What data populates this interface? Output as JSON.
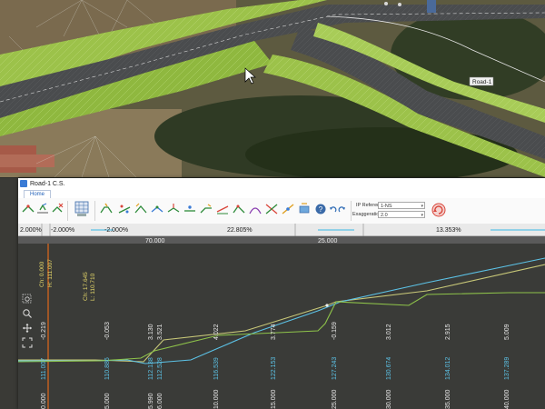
{
  "window": {
    "title": "Road-1 C.S.",
    "tabs": [
      {
        "label": "Home",
        "active": true
      }
    ]
  },
  "ribbon": {
    "ip_reference": {
      "label": "IP Reference:",
      "value": "1-NS"
    },
    "exaggeration": {
      "label": "Exaggeration:",
      "value": "2.0"
    }
  },
  "scene": {
    "road_label": "Road-1"
  },
  "profile": {
    "grade_labels": [
      {
        "text": "2.000%"
      },
      {
        "text": "-2.000%"
      },
      {
        "text": "-2.000%"
      },
      {
        "text": "22.805%"
      },
      {
        "text": "13.353%"
      }
    ],
    "width_labels": [
      {
        "text": "70.000"
      },
      {
        "text": "25.000"
      }
    ],
    "centerline_label_1": "Ch: 0.000",
    "centerline_label_2": "H: 111.007",
    "ch_label_1": "Ch: 17.645",
    "ch_label_2": "L: 110.710",
    "offset_labels": [
      "-0.219",
      "-0.053",
      "3.130",
      "3.521",
      "4.022",
      "3.774",
      "-0.159",
      "3.012",
      "2.915",
      "5.009"
    ],
    "elevation_labels": [
      "111.007",
      "110.886",
      "112.138",
      "112.528",
      "116.539",
      "122.153",
      "127.243",
      "130.674",
      "134.012",
      "137.289"
    ],
    "chainage_labels": [
      "0.000",
      "5.000",
      "5.990",
      "6.000",
      "10.000",
      "15.000",
      "25.000",
      "30.000",
      "35.000",
      "40.000"
    ]
  },
  "colors": {
    "accent": "#1f5fb8",
    "viewer_bg": "#3a3b38",
    "terrain_line": "#c8c878",
    "design_line": "#5cc2e6",
    "existing_line": "#8ec34a",
    "centerline": "#e0691a",
    "label_yellow": "#e6d86a",
    "label_cyan": "#5cc2e6",
    "label_white": "#e8e8e8"
  },
  "icons": {
    "window_icon": "cross-section-icon",
    "view_tools": [
      "window-zoom-icon",
      "zoom-icon",
      "pan-icon",
      "fit-icon"
    ]
  }
}
